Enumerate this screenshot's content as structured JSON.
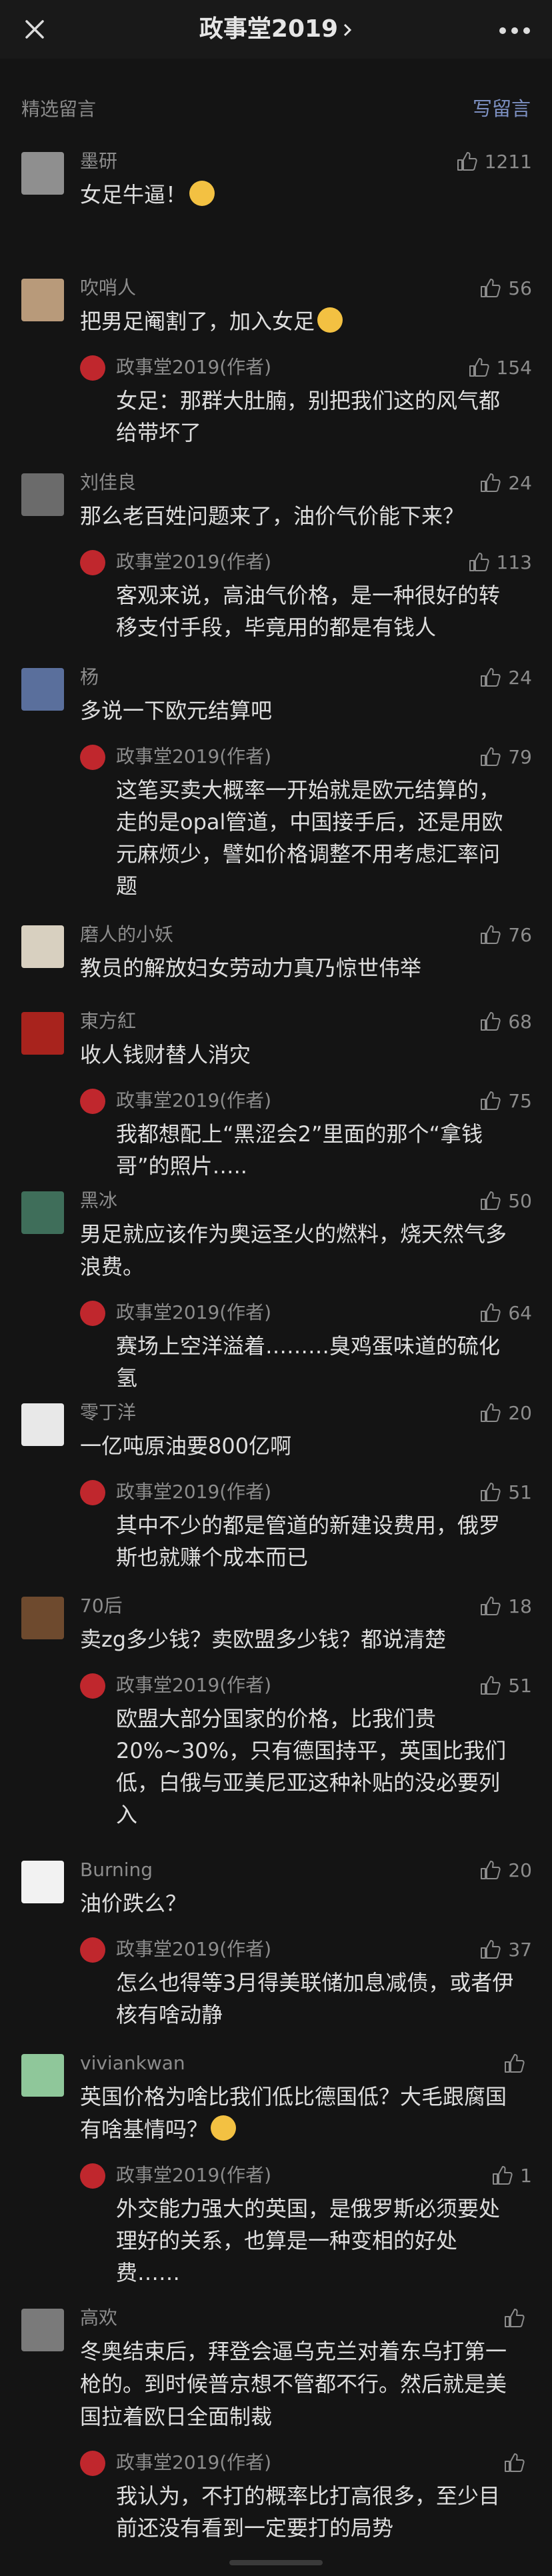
{
  "topbar": {
    "title": "政事堂2019"
  },
  "section": {
    "label": "精选留言",
    "write_button": "写留言"
  },
  "comments": [
    {
      "nickname": "墨研",
      "likes": "1211",
      "text": "女足牛逼！",
      "emoji": "crying-emoji",
      "avatar_color": "#8f8f8f",
      "reply": null
    },
    {
      "nickname": "吹哨人",
      "likes": "56",
      "text": "把男足阉割了，加入女足",
      "emoji": "grinning-emoji",
      "avatar_color": "#b89a7a",
      "reply": {
        "name": "政事堂2019(作者)",
        "likes": "154",
        "text": "女足：那群大肚腩，别把我们这的风气都给带坏了"
      }
    },
    {
      "nickname": "刘佳良",
      "likes": "24",
      "text": "那么老百姓问题来了，油价气价能下来？",
      "emoji": null,
      "avatar_color": "#6b6b6b",
      "reply": {
        "name": "政事堂2019(作者)",
        "likes": "113",
        "text": "客观来说，高油气价格，是一种很好的转移支付手段，毕竟用的都是有钱人"
      }
    },
    {
      "nickname": "杨",
      "likes": "24",
      "text": "多说一下欧元结算吧",
      "emoji": null,
      "avatar_color": "#5a6f9c",
      "reply": {
        "name": "政事堂2019(作者)",
        "likes": "79",
        "text": "这笔买卖大概率一开始就是欧元结算的，走的是opal管道，中国接手后，还是用欧元麻烦少，譬如价格调整不用考虑汇率问题"
      }
    },
    {
      "nickname": "磨人的小妖",
      "likes": "76",
      "text": "教员的解放妇女劳动力真乃惊世伟举",
      "emoji": null,
      "avatar_color": "#d8d0c0",
      "reply": null
    },
    {
      "nickname": "東方紅",
      "likes": "68",
      "text": "收人钱财替人消灾",
      "emoji": null,
      "avatar_color": "#a8231d",
      "reply": {
        "name": "政事堂2019(作者)",
        "likes": "75",
        "text": "我都想配上“黑涩会2”里面的那个“拿钱哥”的照片….."
      }
    },
    {
      "nickname": "黑冰",
      "likes": "50",
      "text": "男足就应该作为奥运圣火的燃料，烧天然气多浪费。",
      "emoji": null,
      "avatar_color": "#3f6e5a",
      "reply": {
        "name": "政事堂2019(作者)",
        "likes": "64",
        "text": "赛场上空洋溢着………臭鸡蛋味道的硫化氢"
      }
    },
    {
      "nickname": "零丁洋",
      "likes": "20",
      "text": "一亿吨原油要800亿啊",
      "emoji": null,
      "avatar_color": "#e8e8e8",
      "reply": {
        "name": "政事堂2019(作者)",
        "likes": "51",
        "text": "其中不少的都是管道的新建设费用，俄罗斯也就赚个成本而已"
      }
    },
    {
      "nickname": "70后",
      "likes": "18",
      "text": "卖zg多少钱？卖欧盟多少钱？都说清楚",
      "emoji": null,
      "avatar_color": "#6e4a2e",
      "reply": {
        "name": "政事堂2019(作者)",
        "likes": "51",
        "text": "欧盟大部分国家的价格，比我们贵20%~30%，只有德国持平，英国比我们低，白俄与亚美尼亚这种补贴的没必要列入"
      }
    },
    {
      "nickname": "Burning",
      "likes": "20",
      "text": "油价跌么？",
      "emoji": null,
      "avatar_color": "#f2f2f2",
      "reply": {
        "name": "政事堂2019(作者)",
        "likes": "37",
        "text": "怎么也得等3月得美联储加息减债，或者伊核有啥动静"
      }
    },
    {
      "nickname": "viviankwan",
      "likes": "",
      "text": "英国价格为啥比我们低比德国低？大毛跟腐国有啥基情吗？",
      "emoji": "thinking-emoji",
      "avatar_color": "#8fc79a",
      "reply": {
        "name": "政事堂2019(作者)",
        "likes": "1",
        "text": "外交能力强大的英国，是俄罗斯必须要处理好的关系，也算是一种变相的好处费……"
      }
    },
    {
      "nickname": "高欢",
      "likes": "",
      "text": "冬奥结束后，拜登会逼乌克兰对着东乌打第一枪的。到时候普京想不管都不行。然后就是美国拉着欧日全面制裁",
      "emoji": null,
      "avatar_color": "#7a7a7a",
      "reply": {
        "name": "政事堂2019(作者)",
        "likes": "",
        "text": "我认为，不打的概率比打高很多，至少目前还没有看到一定要打的局势"
      }
    }
  ]
}
